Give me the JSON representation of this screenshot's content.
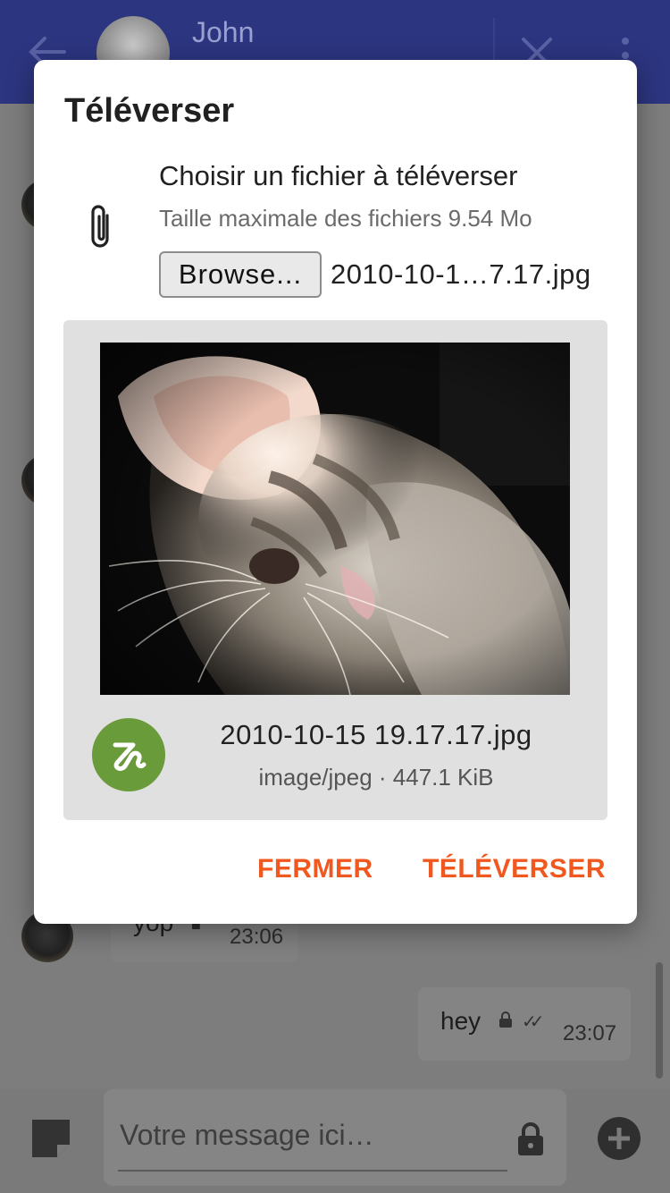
{
  "appbar": {
    "contact_name": "John",
    "back_icon": "arrow-left-icon",
    "close_icon": "close-icon",
    "menu_icon": "more-vertical-icon",
    "background_color": "#2c357f"
  },
  "messages": [
    {
      "text": "yop",
      "time": "23:06",
      "direction": "incoming",
      "encrypted": true
    },
    {
      "text": "hey",
      "time": "23:07",
      "direction": "outgoing",
      "encrypted": true,
      "status": "read"
    }
  ],
  "composer": {
    "placeholder": "Votre message ici…",
    "sticker_icon": "sticker-icon",
    "lock_icon": "lock-icon",
    "add_icon": "add-circle-icon"
  },
  "dialog": {
    "title": "Téléverser",
    "choose_label": "Choisir un fichier à téléverser",
    "max_size": "Taille maximale des fichiers 9.54 Mo",
    "browse_label": "Browse...",
    "selected_file_short": "2010-10-1…7.17.jpg",
    "preview": {
      "file_name": "2010-10-15 19.17.17.jpg",
      "meta": "image/jpeg · 447.1 KiB",
      "icon": "file-type-icon"
    },
    "close_label": "FERMER",
    "upload_label": "TÉLÉVERSER"
  },
  "colors": {
    "accent": "#f0581f",
    "file_icon_bg": "#6a9b3a"
  }
}
